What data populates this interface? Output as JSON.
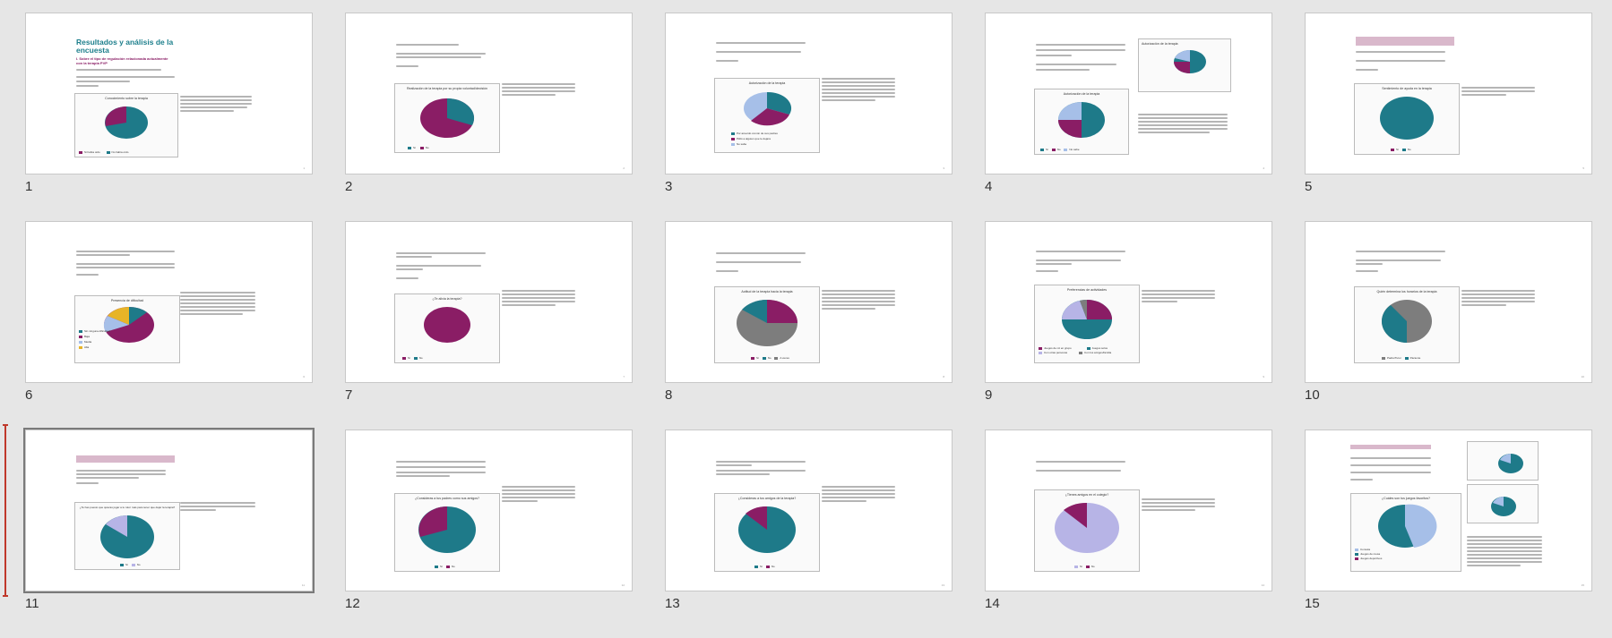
{
  "slides": [
    {
      "num": "1",
      "title": "Resultados y análisis de la encuesta",
      "subtitle": "I. Sobre el tipo de regulación relacionada actualmente con la terapia PVP",
      "chart_title": "Conocimiento sobre la terapia",
      "legend": [
        "Si había oído",
        "No había oído"
      ],
      "values": [
        "36%",
        "64%"
      ]
    },
    {
      "num": "2",
      "chart_title": "Realización de la terapia por su propia voluntad/decisión",
      "legend": [
        "Sí",
        "No"
      ],
      "values": [
        "33%",
        "67%"
      ]
    },
    {
      "num": "3",
      "chart_title": "Autorización de la terapia",
      "legend": [
        "Por acuerdo común de sus padres",
        "Pidió a alguien que le dejara",
        "No sabe"
      ],
      "values": [
        "33%",
        "33%",
        "34%"
      ]
    },
    {
      "num": "4",
      "chart_title": "Autorización de la terapia",
      "legend": [
        "Sí",
        "No",
        "No sabe"
      ],
      "values": [
        "30%",
        "20%",
        "50%"
      ]
    },
    {
      "num": "5",
      "chart_title": "Sentimiento de ayuda en la terapia",
      "legend": [
        "Sí",
        "No"
      ],
      "values": [
        "100%",
        "0%"
      ]
    },
    {
      "num": "6",
      "chart_title": "Presencia de dificultad",
      "legend": [
        "Sin ninguna dificultad",
        "Baja",
        "Media",
        "Alta"
      ],
      "values": [
        "57%",
        "14%",
        "16%",
        "13%"
      ]
    },
    {
      "num": "7",
      "chart_title": "¿Te alivia la terapia?",
      "legend": [
        "Sí",
        "No"
      ],
      "values": [
        "100%",
        "0%"
      ]
    },
    {
      "num": "8",
      "chart_title": "Actitud de la terapia hacia la terapia",
      "legend": [
        "Sí",
        "No",
        "A veces"
      ],
      "values": [
        "27%",
        "17%",
        "56%"
      ]
    },
    {
      "num": "9",
      "chart_title": "Preferencias de actividades",
      "legend": [
        "Juegos de rol en grupo",
        "Juegos solos",
        "Con otras personas",
        "Con los amigos/familia"
      ],
      "values": [
        "33%",
        "33%",
        "17%",
        "17%"
      ]
    },
    {
      "num": "10",
      "chart_title": "Quién determina los horarios de la terapia",
      "legend": [
        "Padre/Tutor",
        "Paciente"
      ],
      "values": [
        "60%",
        "40%"
      ]
    },
    {
      "num": "11",
      "chart_title": "¿Te has puesto que quieras jugar a tu tutor más para tener que dejar la terapia?",
      "legend": [
        "Sí",
        "No"
      ],
      "values": [
        "83%",
        "17%"
      ]
    },
    {
      "num": "12",
      "chart_title": "¿Consideras a tus padres como sus amigos?",
      "legend": [
        "Sí",
        "No"
      ],
      "values": [
        "67%",
        "33%"
      ]
    },
    {
      "num": "13",
      "chart_title": "¿Consideras a tus amigos de la terapia?",
      "legend": [
        "Sí",
        "No"
      ],
      "values": [
        "83%",
        "17%"
      ]
    },
    {
      "num": "14",
      "chart_title": "¿Tienes amigos en el colegio?",
      "legend": [
        "Sí",
        "No"
      ],
      "values": [
        "83%",
        "17%"
      ]
    },
    {
      "num": "15",
      "chart_title": "¿Cuáles son tus juegos favoritos?",
      "legend": [
        "Consola",
        "Juegos de mesa",
        "Juegos deportivos"
      ],
      "values": [
        "50%",
        "33%",
        "17%"
      ]
    }
  ],
  "colors": {
    "teal": "#1e7a89",
    "magenta": "#8a1d65",
    "lightblue": "#a6bfe8",
    "gray": "#7d7d7d",
    "lavender": "#b7b4e6",
    "yellow": "#e7b427"
  }
}
